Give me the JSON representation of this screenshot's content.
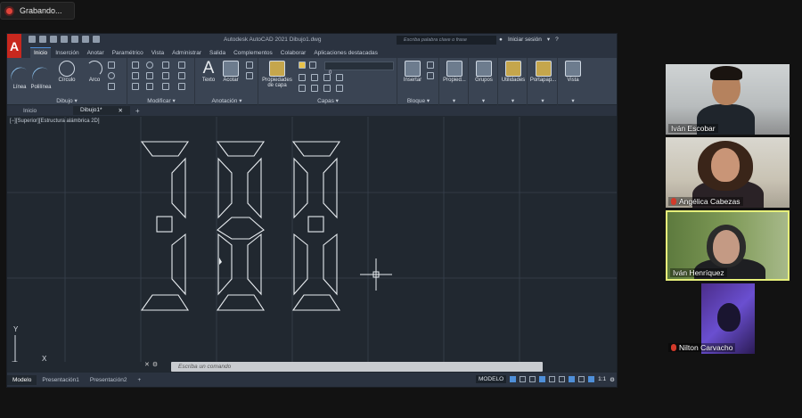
{
  "recording": {
    "label": "Grabando..."
  },
  "autocad": {
    "logo": "A",
    "title": "Autodesk AutoCAD 2021    Dibujo1.dwg",
    "search_placeholder": "Escriba palabra clave o frase",
    "signin": "Iniciar sesión",
    "tabs": [
      "Inicio",
      "Inserción",
      "Anotar",
      "Paramétrico",
      "Vista",
      "Administrar",
      "Salida",
      "Complementos",
      "Colaborar",
      "Aplicaciones destacadas"
    ],
    "ribbon": {
      "dibujo": {
        "label": "Dibujo ▾",
        "tools": [
          "Línea",
          "Polilínea",
          "Círculo",
          "Arco"
        ]
      },
      "modificar": {
        "label": "Modificar ▾"
      },
      "anotacion": {
        "label": "Anotación ▾",
        "tools": [
          "Texto",
          "Acotar"
        ]
      },
      "capas": {
        "label": "Capas ▾",
        "tool": "Propiedades de capa",
        "current_layer": "0"
      },
      "bloque": {
        "label": "Bloque ▾",
        "tool": "Insertar"
      },
      "extra": [
        "Propied...",
        "Grupos",
        "Utilidades",
        "Portapap...",
        "Vista"
      ]
    },
    "doc_tabs": [
      "Inicio",
      "Dibujo1*"
    ],
    "viewport_label": "[−][Superior][Estructura alámbrica 2D]",
    "command_placeholder": "Escriba un comando",
    "layout_tabs": [
      "Modelo",
      "Presentación1",
      "Presentación2"
    ],
    "status": {
      "model": "MODELO",
      "scale": "1:1"
    }
  },
  "participants": [
    {
      "name": "Iván Escobar",
      "muted": false
    },
    {
      "name": "Angélica Cabezas",
      "muted": true
    },
    {
      "name": "Iván Henríquez",
      "muted": false,
      "active": true
    },
    {
      "name": "Nilton Carvacho",
      "muted": true
    }
  ]
}
